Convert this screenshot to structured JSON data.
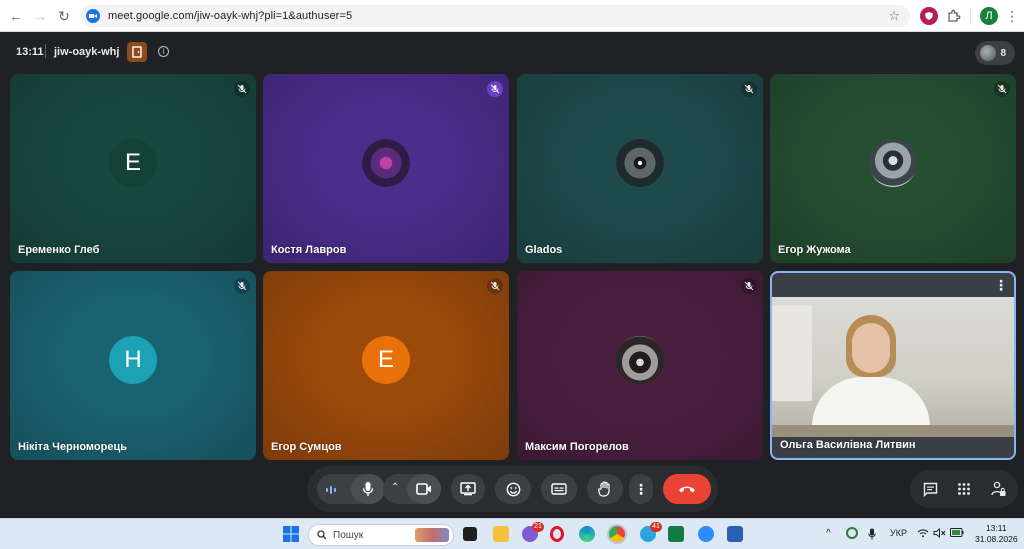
{
  "browser": {
    "url": "meet.google.com/jiw-oayk-whj?pli=1&authuser=5",
    "profile_initial": "Л"
  },
  "meeting": {
    "time": "13:11",
    "code": "jiw-oayk-whj",
    "participant_count": "8"
  },
  "participants": [
    {
      "name": "Еременко Глеб",
      "avatar_type": "letter",
      "initial": "Е",
      "tile_color": "#19483f",
      "avatar_color": "#154236",
      "muted": true
    },
    {
      "name": "Костя Лавров",
      "avatar_type": "image",
      "tile_color": "#4b2d8c",
      "muted": true,
      "mute_badge_color": "#6b3fbf"
    },
    {
      "name": "Glados",
      "avatar_type": "image",
      "tile_color": "#1f4a4c",
      "muted": true
    },
    {
      "name": "Егор Жужома",
      "avatar_type": "image",
      "tile_color": "#264e33",
      "muted": true
    },
    {
      "name": "Нікіта Черноморець",
      "avatar_type": "letter",
      "initial": "Н",
      "tile_color": "#1b6270",
      "avatar_color": "#1da1b5",
      "muted": true
    },
    {
      "name": "Егор Сумцов",
      "avatar_type": "letter",
      "initial": "Е",
      "tile_color": "#9b4a0c",
      "avatar_color": "#e8710a",
      "muted": true
    },
    {
      "name": "Максим Погорелов",
      "avatar_type": "image",
      "tile_color": "#4a1f3f",
      "muted": true
    },
    {
      "name": "Ольга Василівна Литвин",
      "avatar_type": "video",
      "tile_color": "#cfd3d3",
      "muted": false,
      "active": true
    }
  ],
  "controls": {
    "buttons": [
      "mic",
      "camera",
      "present",
      "reactions",
      "captions",
      "raise-hand",
      "more",
      "leave"
    ]
  },
  "taskbar": {
    "search_placeholder": "Пошук",
    "chrome_badge": "21",
    "telegram_badge": "41",
    "language": "УКР",
    "time": "13:11",
    "date": "31.08.2026"
  },
  "colors": {
    "meet_bg": "#202124",
    "leave_red": "#ea4335",
    "accent_blue": "#1a73e8"
  }
}
